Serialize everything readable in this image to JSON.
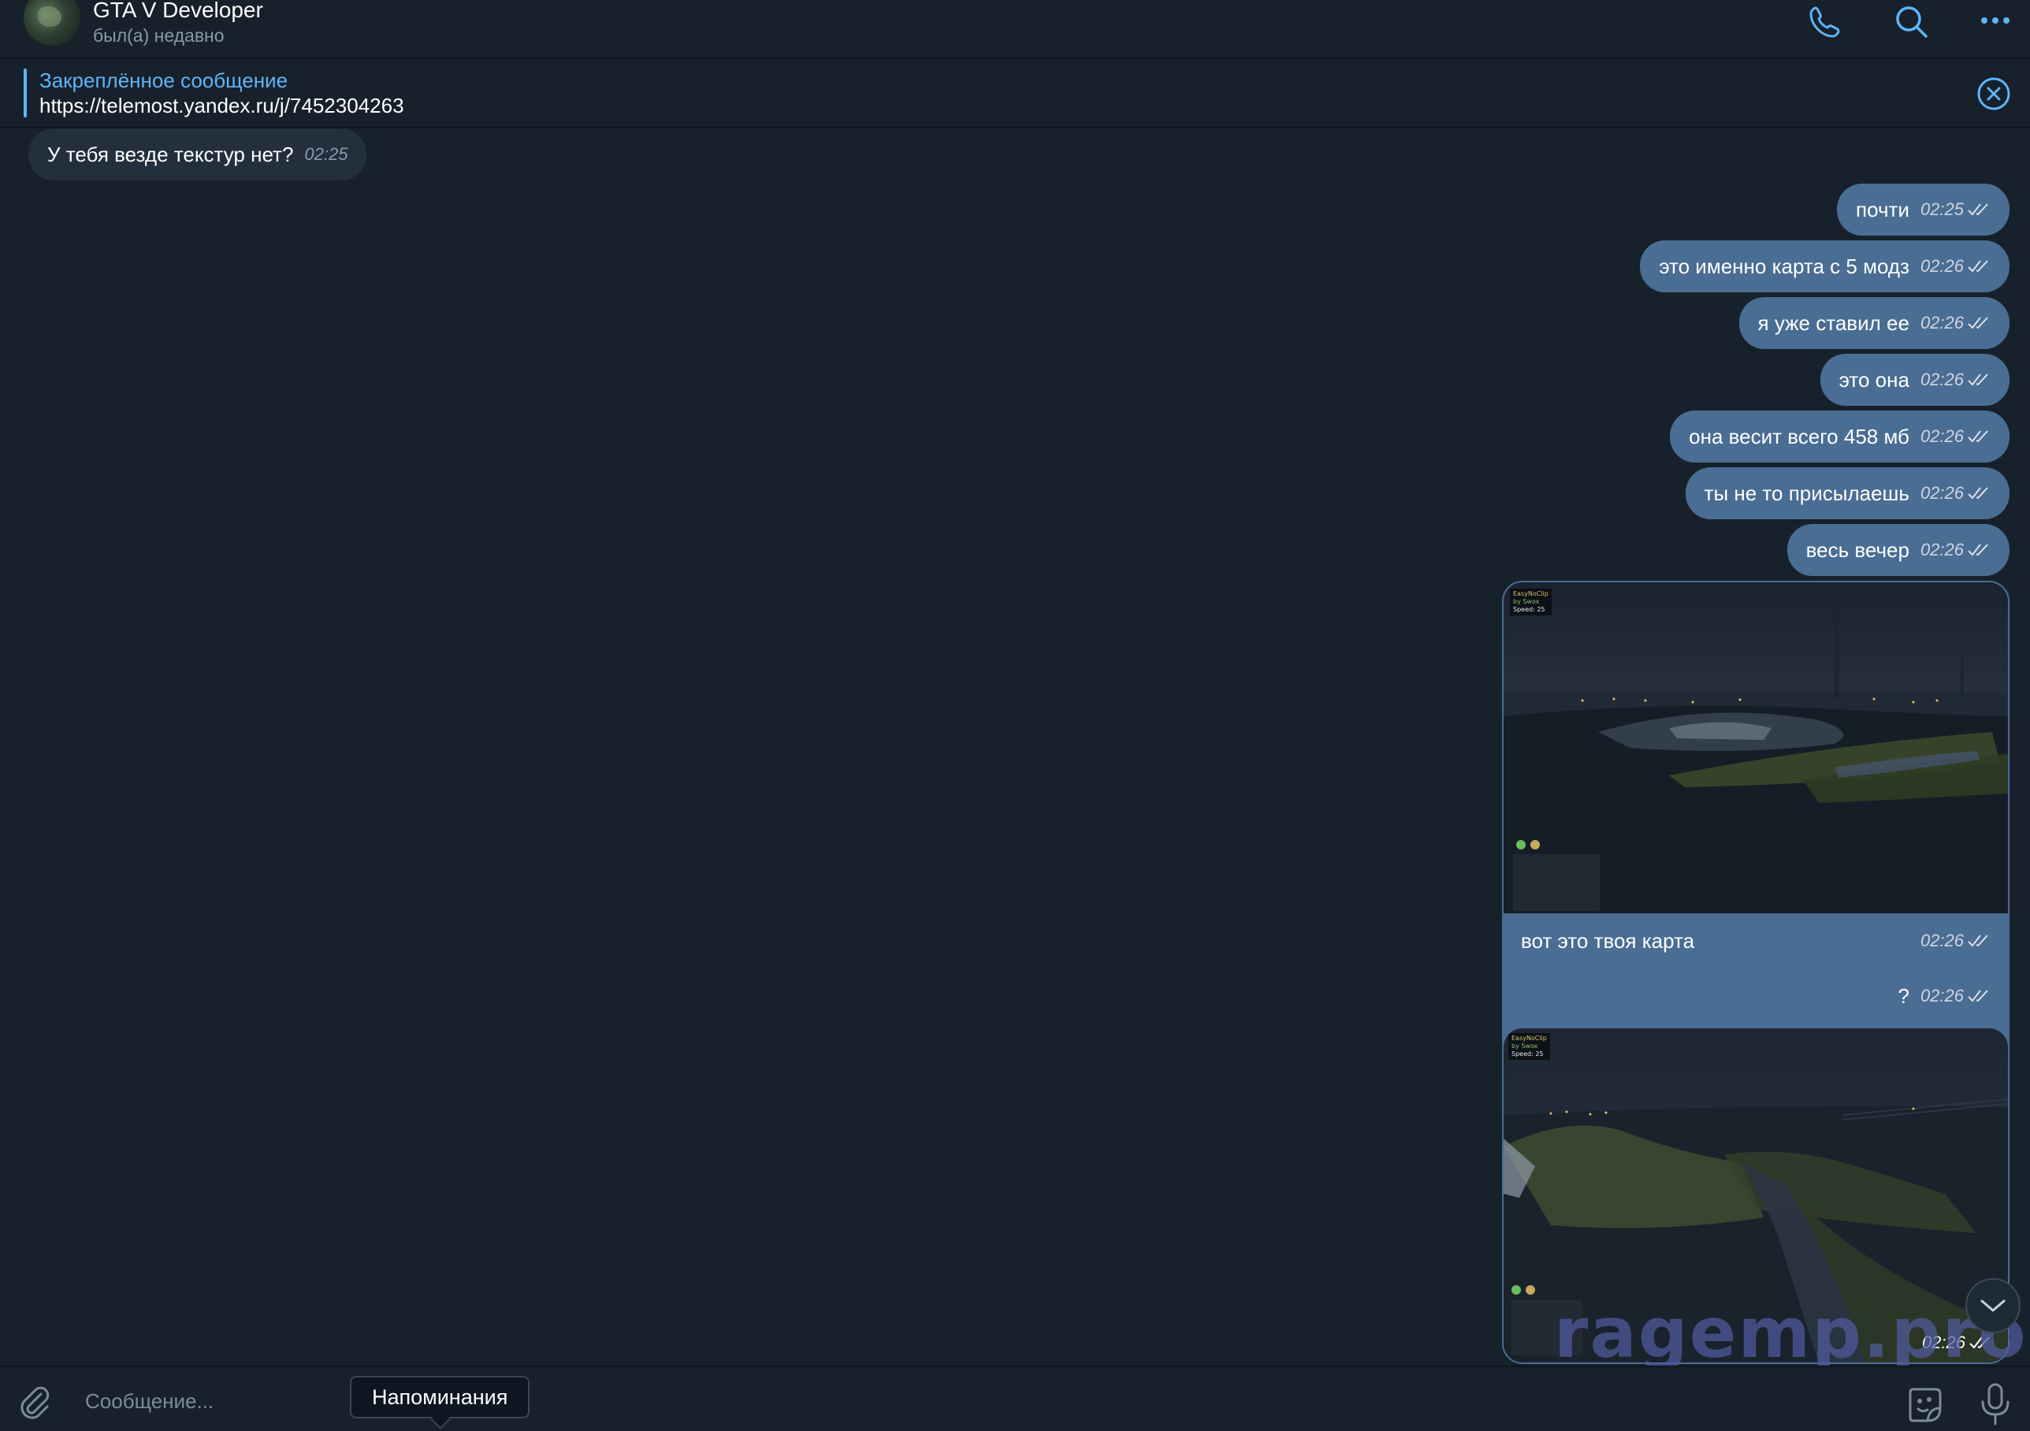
{
  "header": {
    "title": "GTA V Developer",
    "status": "был(а) недавно",
    "icons": [
      "phone-icon",
      "search-icon",
      "more-icon"
    ]
  },
  "pinned": {
    "title": "Закреплённое сообщение",
    "text": "https://telemost.yandex.ru/j/7452304263"
  },
  "messages": [
    {
      "side": "in",
      "text": "У тебя везде текстур нет?",
      "time": "02:25"
    },
    {
      "side": "out",
      "text": "почти",
      "time": "02:25",
      "read": true
    },
    {
      "side": "out",
      "text": "это именно карта с 5 модз",
      "time": "02:26",
      "read": true
    },
    {
      "side": "out",
      "text": "я уже ставил ее",
      "time": "02:26",
      "read": true
    },
    {
      "side": "out",
      "text": "это она",
      "time": "02:26",
      "read": true
    },
    {
      "side": "out",
      "text": "она весит всего 458 мб",
      "time": "02:26",
      "read": true
    },
    {
      "side": "out",
      "text": "ты не то присылаешь",
      "time": "02:26",
      "read": true
    },
    {
      "side": "out",
      "text": "весь вечер",
      "time": "02:26",
      "read": true
    },
    {
      "side": "out",
      "type": "photo",
      "caption": "вот это твоя карта",
      "time": "02:26",
      "read": true,
      "hud": {
        "line1": "EasyNoClip",
        "line2": "by Swox",
        "line3": "Speed: 25"
      }
    },
    {
      "side": "out",
      "text": "?",
      "time": "02:26",
      "read": true
    },
    {
      "side": "out",
      "type": "photo",
      "caption": "",
      "time": "02:26",
      "read": true,
      "hud": {
        "line1": "EasyNoClip",
        "line2": "by Swox",
        "line3": "Speed: 25"
      }
    }
  ],
  "watermark": "ragemp.pro",
  "composer": {
    "placeholder": "Сообщение...",
    "tooltip": "Напоминания"
  },
  "colors": {
    "background": "#17212b",
    "bubble_out": "#4a6d93",
    "bubble_in": "#232f3d",
    "accent": "#5eb5f7"
  }
}
